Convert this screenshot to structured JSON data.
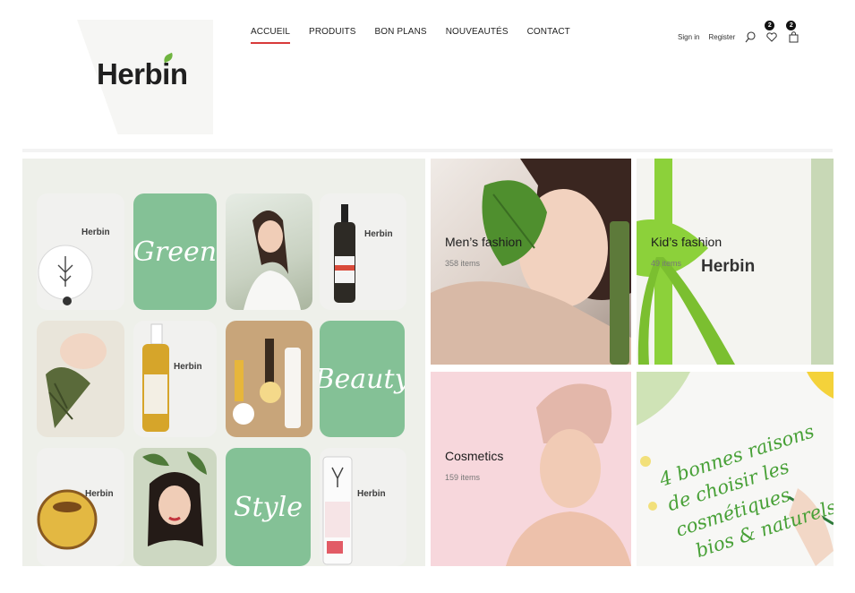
{
  "brand": {
    "logo": "Herbin"
  },
  "nav": [
    {
      "label": "ACCUEIL",
      "active": true
    },
    {
      "label": "PRODUITS",
      "active": false
    },
    {
      "label": "BON PLANS",
      "active": false
    },
    {
      "label": "NOUVEAUTÉS",
      "active": false
    },
    {
      "label": "CONTACT",
      "active": false
    }
  ],
  "account": {
    "sign_in": "Sign in",
    "register": "Register"
  },
  "wishlist": {
    "count": "2"
  },
  "cart": {
    "count": "2"
  },
  "collage": {
    "tile_words": [
      "Green",
      "Beauty",
      "Style"
    ],
    "product_logo": "Herbin"
  },
  "categories": [
    {
      "title": "Men’s fashion",
      "count": "358 items"
    },
    {
      "title": "Kid’s fashion",
      "count": "49 items"
    },
    {
      "title": "Cosmetics",
      "count": "159 items"
    }
  ],
  "promo": {
    "lines": [
      "4 bonnes raisons",
      "de choisir les cosmétiques",
      "bios & naturels"
    ]
  },
  "colors": {
    "accent_red": "#d83a3a",
    "sage_green": "#84c196",
    "leaf_green": "#6fb43f",
    "pink": "#f7d7dc"
  }
}
